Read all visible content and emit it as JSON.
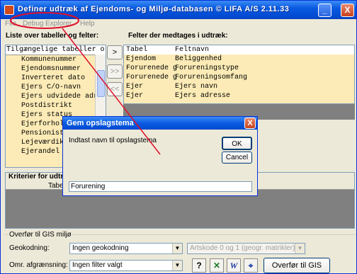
{
  "window": {
    "title": "Definer udtræk af Ejendoms- og Miljø-databasen © LIFA A/S 2.11.33",
    "controls": {
      "minimize": "_",
      "close": "X"
    }
  },
  "menu": [
    "File",
    "Debug",
    "Explorer",
    "Help"
  ],
  "left_panel": {
    "label": "Liste over tabeller og felter:",
    "list_header": "Tilgængelige tabeller o",
    "items": [
      "Kommunenummer",
      "Ejendomsnummer",
      "Inverteret dato",
      "Ejers C/O-navn",
      "Ejers udvidede adre",
      "Postdistrikt",
      "Ejers status",
      "Ejerforhold",
      "Pensionistk",
      "Lejeværdik",
      "Ejerandel"
    ]
  },
  "move_buttons": {
    "add": ">",
    "add_all": ">>",
    "remove": "<<"
  },
  "right_panel": {
    "label": "Felter der medtages i udtræk:",
    "columns": [
      "Tabel",
      "Feltnavn"
    ],
    "rows": [
      [
        "Ejendom",
        "Beliggenhed"
      ],
      [
        "Forurenede g",
        "Forureningstype"
      ],
      [
        "Forurenede g",
        "Forureningsomfang"
      ],
      [
        "Ejer",
        "Ejers navn"
      ],
      [
        "Ejer",
        "Ejers adresse"
      ]
    ]
  },
  "criteria": {
    "label": "Kriterier for udtra",
    "column": "Tabe"
  },
  "bottom": {
    "group_label": "Overfør til GIS miljø",
    "geocoding_label": "Geokodning:",
    "geocoding_value": "Ingen geokodning",
    "artskode_value": "Artskode 0 og 1 (geogr. matrikler)",
    "area_label": "Omr. afgrænsning:",
    "area_value": "Ingen filter valgt",
    "help_icon": "?",
    "gis_button": "Overfør til GIS"
  },
  "dialog": {
    "title": "Gem opslagstema",
    "prompt": "Indtast navn til opslagstema",
    "ok": "OK",
    "cancel": "Cancel",
    "input_value": "Forurening",
    "close": "X"
  },
  "colors": {
    "list_bg": "#fcebb6",
    "title_blue": "#0a5be1",
    "annotation_red": "#e0102a"
  }
}
